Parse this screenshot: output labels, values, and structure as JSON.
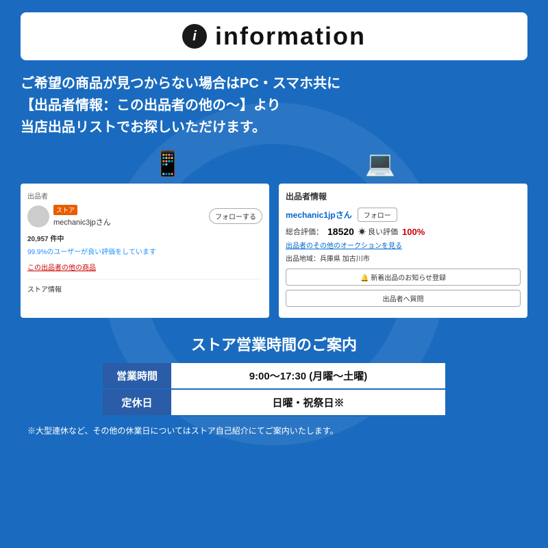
{
  "header": {
    "icon_label": "i",
    "title": "information"
  },
  "intro": {
    "line1": "ご希望の商品が見つからない場合はPC・スマホ共に",
    "line2": "【出品者情報：この出品者の他の〜】より",
    "line3": "当店出品リストでお探しいただけます。"
  },
  "screenshot_left": {
    "section_label": "出品者",
    "store_badge": "ストア",
    "seller_name": "mechanic3jpさん",
    "follow_btn": "フォローする",
    "count": "20,957 件中",
    "good_rating_text": "99.9%のユーザーが良い評価をしています",
    "link_text": "この出品者の他の商品",
    "store_info": "ストア情報"
  },
  "screenshot_right": {
    "title": "出品者情報",
    "seller_name": "mechanic1jpさん",
    "follow_btn": "フォロー",
    "rating_label": "総合評価：",
    "rating_num": "18520",
    "good_label": "☀ 良い評価",
    "good_pct": "100%",
    "auction_link": "出品者のその他のオークションを見る",
    "location_label": "出品地域：兵庫県 加古川市",
    "btn_notify": "🔔 新着出品のお知らせ登録",
    "btn_question": "出品者へ質問"
  },
  "store_hours": {
    "title": "ストア営業時間のご案内",
    "rows": [
      {
        "label": "営業時間",
        "value": "9:00〜17:30 (月曜〜土曜)"
      },
      {
        "label": "定休日",
        "value": "日曜・祝祭日※"
      }
    ],
    "note": "※大型連休など、その他の休業日についてはストア自己紹介にてご案内いたします。"
  }
}
